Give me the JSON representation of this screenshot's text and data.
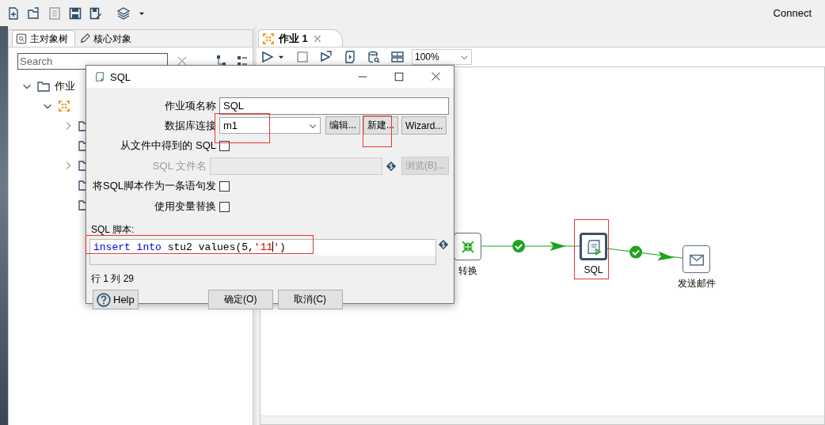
{
  "toolbar": {
    "connect": "Connect"
  },
  "left_panel": {
    "tabs": [
      {
        "label": "主对象树",
        "selected": true
      },
      {
        "label": "核心对象",
        "selected": false
      }
    ],
    "search": {
      "placeholder": "Search"
    },
    "tree": [
      {
        "label": "作业",
        "kind": "folder",
        "expanded": true,
        "children": [
          {
            "kind": "job",
            "expanded": true,
            "children": [
              {
                "kind": "folder",
                "expanded": false,
                "collapsed": true
              },
              {
                "kind": "folder",
                "expanded": false,
                "collapsed": false
              },
              {
                "kind": "folder",
                "expanded": false,
                "collapsed": true
              },
              {
                "kind": "folder",
                "expanded": false,
                "collapsed": false
              },
              {
                "kind": "folder",
                "expanded": false,
                "collapsed": false
              }
            ]
          }
        ]
      }
    ]
  },
  "editor": {
    "tabs": [
      {
        "label": "作业 1",
        "selected": true
      }
    ],
    "zoom": "100%",
    "nodes": [
      {
        "kind": "transform",
        "label": "转换",
        "highlighted": false
      },
      {
        "kind": "sql",
        "label": "SQL",
        "highlighted": true
      },
      {
        "kind": "mail",
        "label": "发送邮件",
        "highlighted": false
      }
    ],
    "hops": [
      {
        "kind": "success"
      },
      {
        "kind": "success"
      }
    ]
  },
  "dialog": {
    "title": "SQL",
    "fields": [
      {
        "kind": "text",
        "label": "作业项名称",
        "value": "SQL"
      },
      {
        "kind": "select",
        "label": "数据库连接",
        "value": "m1",
        "highlighted": true,
        "buttons": [
          {
            "label": "编辑...",
            "highlighted": false
          },
          {
            "label": "新建...",
            "highlighted": true
          },
          {
            "label": "Wizard...",
            "highlighted": false
          }
        ]
      },
      {
        "kind": "checkbox",
        "label": "从文件中得到的 SQL",
        "checked": false
      },
      {
        "kind": "file",
        "label": "SQL 文件名",
        "disabled": true,
        "button": "浏览(B)..."
      },
      {
        "kind": "checkbox",
        "label": "将SQL脚本作为一条语句发",
        "checked": false
      },
      {
        "kind": "checkbox",
        "label": "使用变量替换",
        "checked": false
      }
    ],
    "script": {
      "label": "SQL 脚本:",
      "highlighted": true,
      "tokens": [
        {
          "kind": "keyword",
          "text": "insert"
        },
        {
          "kind": "keyword",
          "text": " into"
        },
        {
          "kind": "plain",
          "text": " stu2 values(5,"
        },
        {
          "kind": "string",
          "text": "'11",
          "caret": true
        },
        {
          "kind": "string",
          "text": "'"
        },
        {
          "kind": "plain",
          "text": ")"
        }
      ]
    },
    "position": "行 1 列 29",
    "buttons": [
      {
        "kind": "help",
        "label": "Help"
      },
      {
        "kind": "plain",
        "label": "确定(O)"
      },
      {
        "kind": "plain",
        "label": "取消(C)"
      }
    ]
  }
}
